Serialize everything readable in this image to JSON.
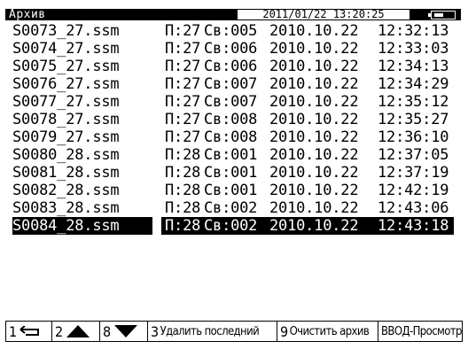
{
  "header": {
    "title": "Архив",
    "datetime": "2011/01/22 13:20:25",
    "battery": "battery-icon"
  },
  "files": [
    {
      "name": "S0073_27.ssm",
      "part": "П:27",
      "sv": "Св:005",
      "date": "2010.10.22",
      "time": "12:32:13"
    },
    {
      "name": "S0074_27.ssm",
      "part": "П:27",
      "sv": "Св:006",
      "date": "2010.10.22",
      "time": "12:33:03"
    },
    {
      "name": "S0075_27.ssm",
      "part": "П:27",
      "sv": "Св:006",
      "date": "2010.10.22",
      "time": "12:34:13"
    },
    {
      "name": "S0076_27.ssm",
      "part": "П:27",
      "sv": "Св:007",
      "date": "2010.10.22",
      "time": "12:34:29"
    },
    {
      "name": "S0077_27.ssm",
      "part": "П:27",
      "sv": "Св:007",
      "date": "2010.10.22",
      "time": "12:35:12"
    },
    {
      "name": "S0078_27.ssm",
      "part": "П:27",
      "sv": "Св:008",
      "date": "2010.10.22",
      "time": "12:35:27"
    },
    {
      "name": "S0079_27.ssm",
      "part": "П:27",
      "sv": "Св:008",
      "date": "2010.10.22",
      "time": "12:36:10"
    },
    {
      "name": "S0080_28.ssm",
      "part": "П:28",
      "sv": "Св:001",
      "date": "2010.10.22",
      "time": "12:37:05"
    },
    {
      "name": "S0081_28.ssm",
      "part": "П:28",
      "sv": "Св:001",
      "date": "2010.10.22",
      "time": "12:37:19"
    },
    {
      "name": "S0082_28.ssm",
      "part": "П:28",
      "sv": "Св:001",
      "date": "2010.10.22",
      "time": "12:42:19"
    },
    {
      "name": "S0083_28.ssm",
      "part": "П:28",
      "sv": "Св:002",
      "date": "2010.10.22",
      "time": "12:43:06"
    },
    {
      "name": "S0084_28.ssm",
      "part": "П:28",
      "sv": "Св:002",
      "date": "2010.10.22",
      "time": "12:43:18"
    }
  ],
  "selected_index": 11,
  "fkeys": [
    {
      "num": "1",
      "icon": "back-arrow-icon",
      "label": ""
    },
    {
      "num": "2",
      "icon": "up-triangle-icon",
      "label": ""
    },
    {
      "num": "8",
      "icon": "down-triangle-icon",
      "label": ""
    },
    {
      "num": "3",
      "icon": "",
      "label": "Удалить последний"
    },
    {
      "num": "9",
      "icon": "",
      "label": "Очистить архив"
    },
    {
      "num": "",
      "icon": "",
      "label": "ВВОД-Просмотр"
    }
  ]
}
